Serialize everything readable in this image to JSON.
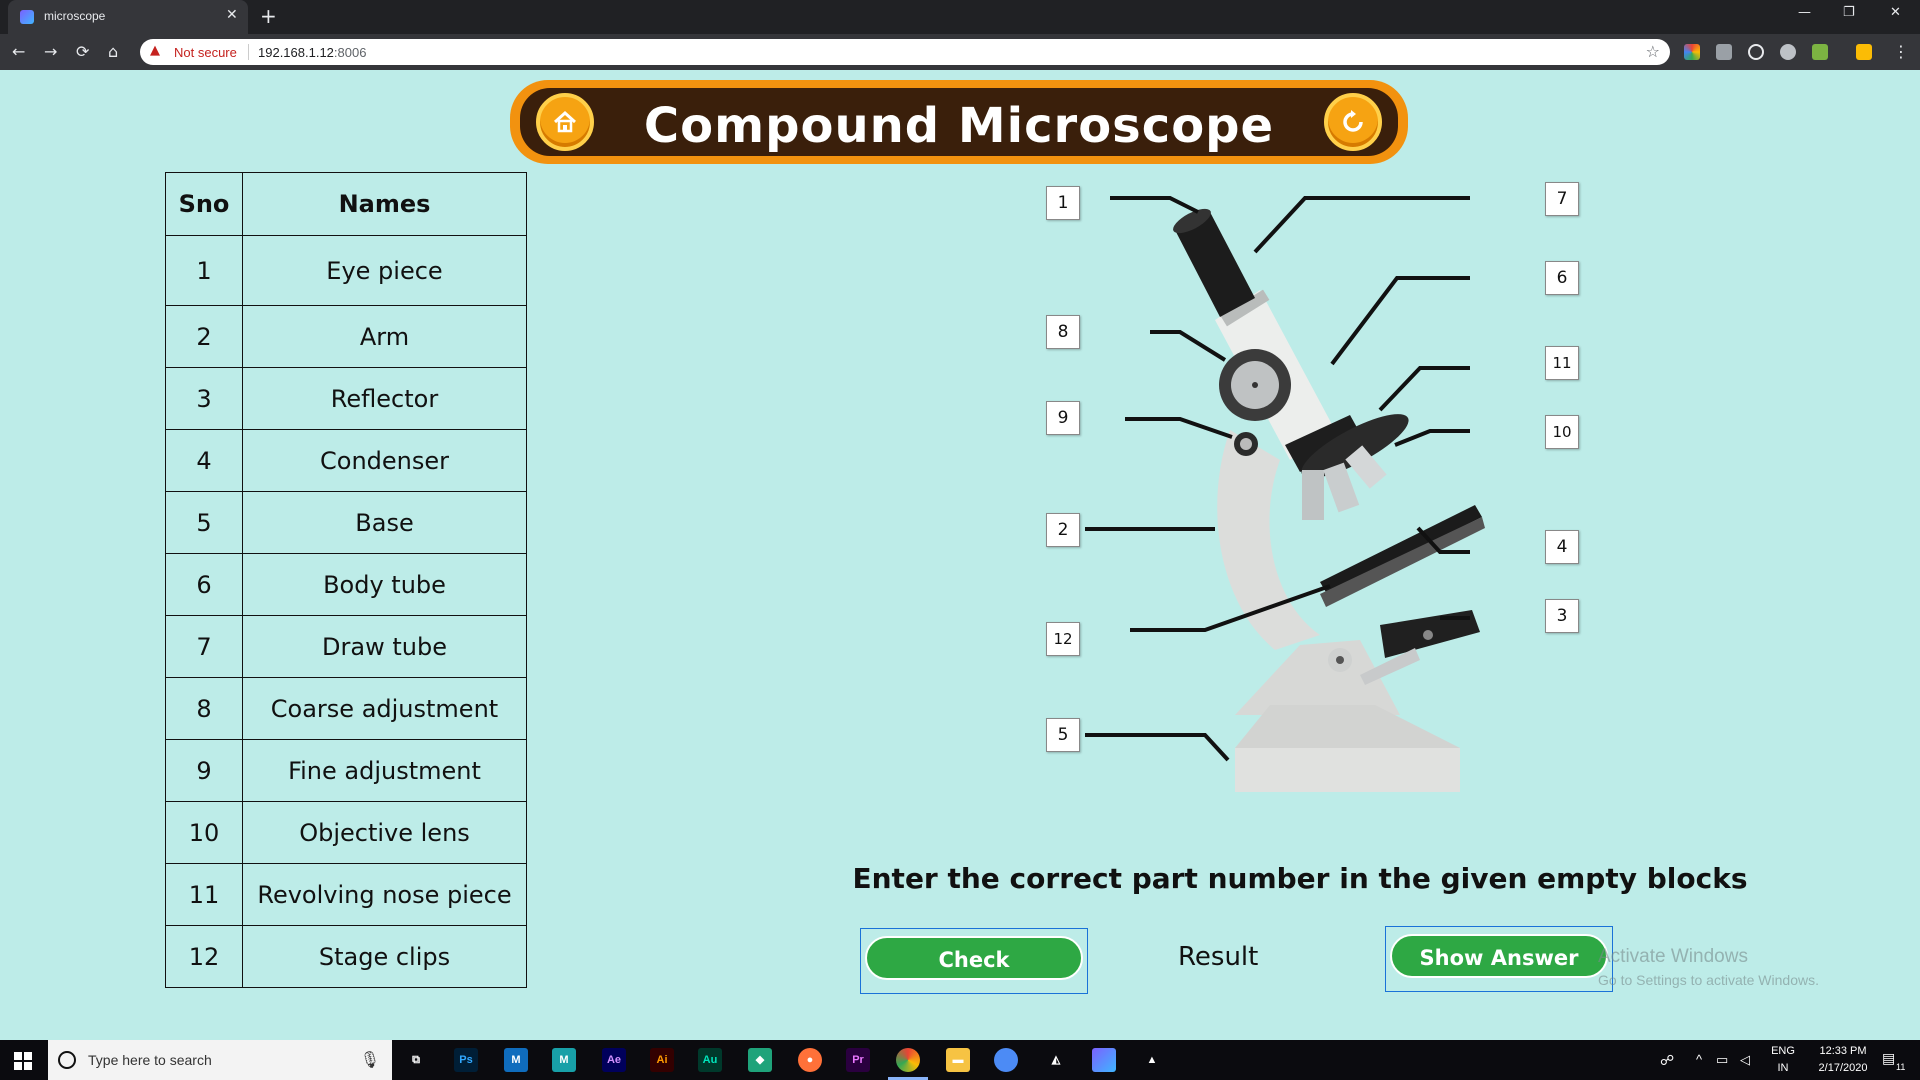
{
  "browser": {
    "tab_title": "microscope",
    "security_label": "Not secure",
    "url_host": "192.168.1.12",
    "url_port": ":8006"
  },
  "app": {
    "title": "Compound Microscope",
    "home_icon": "home-icon",
    "reload_icon": "refresh-icon"
  },
  "table": {
    "headers": [
      "Sno",
      "Names"
    ],
    "rows": [
      {
        "sno": "1",
        "name": "Eye piece"
      },
      {
        "sno": "2",
        "name": "Arm"
      },
      {
        "sno": "3",
        "name": "Reflector"
      },
      {
        "sno": "4",
        "name": "Condenser"
      },
      {
        "sno": "5",
        "name": "Base"
      },
      {
        "sno": "6",
        "name": "Body tube"
      },
      {
        "sno": "7",
        "name": "Draw tube"
      },
      {
        "sno": "8",
        "name": "Coarse adjustment"
      },
      {
        "sno": "9",
        "name": "Fine adjustment"
      },
      {
        "sno": "10",
        "name": "Objective lens"
      },
      {
        "sno": "11",
        "name": "Revolving nose piece"
      },
      {
        "sno": "12",
        "name": "Stage clips"
      }
    ]
  },
  "diagram_labels": {
    "l1": "1",
    "l7": "7",
    "l6": "6",
    "l8": "8",
    "l11": "11",
    "l9": "9",
    "l10": "10",
    "l2": "2",
    "l4": "4",
    "l3": "3",
    "l12": "12",
    "l5": "5"
  },
  "instruction": "Enter the correct part number in the given empty blocks",
  "buttons": {
    "check": "Check",
    "show_answer": "Show Answer"
  },
  "result_label": "Result",
  "watermark": {
    "line1": "Activate Windows",
    "line2": "Go to Settings to activate Windows."
  },
  "taskbar": {
    "search_placeholder": "Type here to search",
    "lang": "ENG",
    "region": "IN",
    "time": "12:33 PM",
    "date": "2/17/2020",
    "notification_count": "11"
  }
}
